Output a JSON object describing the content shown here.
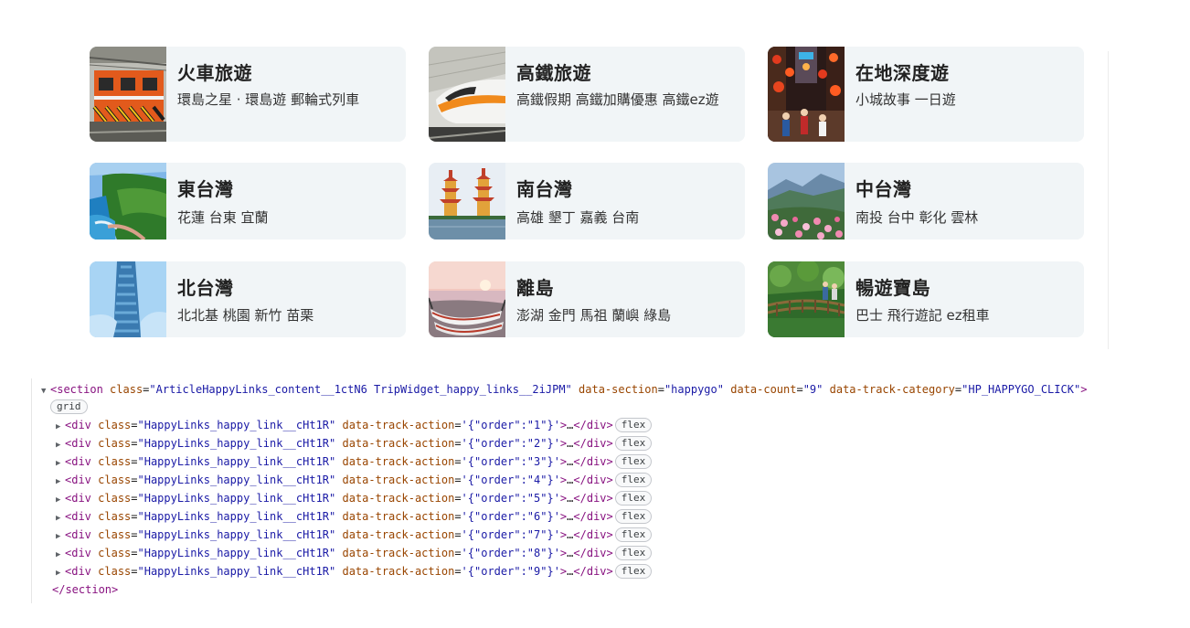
{
  "cards": [
    {
      "title": "火車旅遊",
      "subtitle": "環島之星 · 環島遊 郵輪式列車",
      "image": "train-photo"
    },
    {
      "title": "高鐵旅遊",
      "subtitle": "高鐵假期 高鐵加購優惠 高鐵ez遊",
      "image": "high-speed-rail-photo"
    },
    {
      "title": "在地深度遊",
      "subtitle": "小城故事 一日遊",
      "image": "old-street-lanterns-photo"
    },
    {
      "title": "東台灣",
      "subtitle": "花蓮 台東 宜蘭",
      "image": "east-coast-cliff-photo"
    },
    {
      "title": "南台灣",
      "subtitle": "高雄 墾丁 嘉義 台南",
      "image": "pagoda-photo"
    },
    {
      "title": "中台灣",
      "subtitle": "南投 台中 彰化 雲林",
      "image": "mountain-flowers-photo"
    },
    {
      "title": "北台灣",
      "subtitle": "北北基 桃園 新竹 苗栗",
      "image": "waterfall-photo"
    },
    {
      "title": "離島",
      "subtitle": "澎湖 金門 馬祖 蘭嶼 綠島",
      "image": "canoes-sunset-photo"
    },
    {
      "title": "暢遊寶島",
      "subtitle": "巴士 飛行遊記 ez租車",
      "image": "forest-bridge-photo"
    }
  ],
  "devtools": {
    "section_open": {
      "tag": "section",
      "class_value": "\"ArticleHappyLinks_content__1ctN6 TripWidget_happy_links__2iJPM\"",
      "data_section": "\"happygo\"",
      "data_count": "\"9\"",
      "data_track_category": "\"HP_HAPPYGO_CLICK\"",
      "badge": "grid"
    },
    "children": [
      {
        "class_value": "\"HappyLinks_happy_link__cHt1R\"",
        "action_value": "'{\"order\":\"1\"}'",
        "badge": "flex"
      },
      {
        "class_value": "\"HappyLinks_happy_link__cHt1R\"",
        "action_value": "'{\"order\":\"2\"}'",
        "badge": "flex"
      },
      {
        "class_value": "\"HappyLinks_happy_link__cHt1R\"",
        "action_value": "'{\"order\":\"3\"}'",
        "badge": "flex"
      },
      {
        "class_value": "\"HappyLinks_happy_link__cHt1R\"",
        "action_value": "'{\"order\":\"4\"}'",
        "badge": "flex"
      },
      {
        "class_value": "\"HappyLinks_happy_link__cHt1R\"",
        "action_value": "'{\"order\":\"5\"}'",
        "badge": "flex"
      },
      {
        "class_value": "\"HappyLinks_happy_link__cHt1R\"",
        "action_value": "'{\"order\":\"6\"}'",
        "badge": "flex"
      },
      {
        "class_value": "\"HappyLinks_happy_link__cHt1R\"",
        "action_value": "'{\"order\":\"7\"}'",
        "badge": "flex"
      },
      {
        "class_value": "\"HappyLinks_happy_link__cHt1R\"",
        "action_value": "'{\"order\":\"8\"}'",
        "badge": "flex"
      },
      {
        "class_value": "\"HappyLinks_happy_link__cHt1R\"",
        "action_value": "'{\"order\":\"9\"}'",
        "badge": "flex"
      }
    ],
    "section_close": "</section>"
  }
}
